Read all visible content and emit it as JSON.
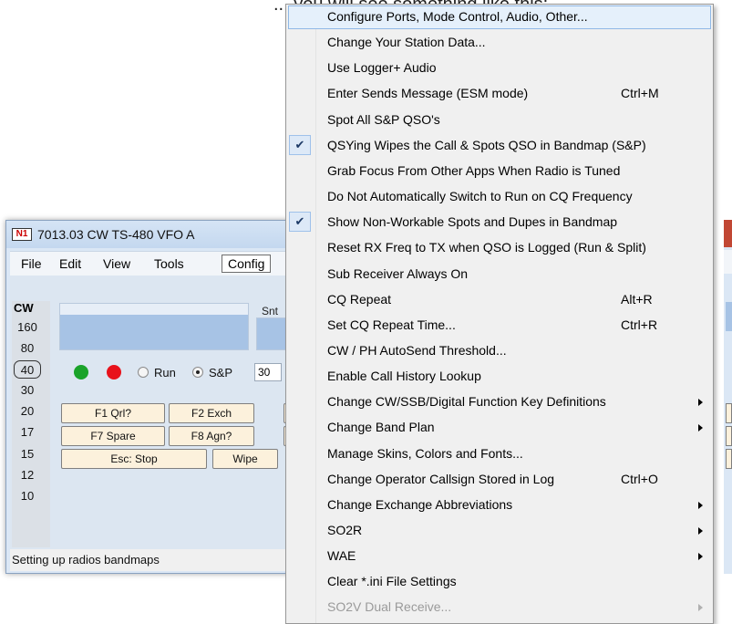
{
  "top_text": "... you will see something like this:",
  "window": {
    "icon_text": "N1",
    "title": "7013.03 CW TS-480 VFO A",
    "menu": [
      "File",
      "Edit",
      "View",
      "Tools",
      "Config"
    ],
    "mode": "CW",
    "bands": [
      "160",
      "80",
      "40",
      "30",
      "20",
      "17",
      "15",
      "12",
      "10"
    ],
    "selected_band": "40",
    "snt_label": "Snt",
    "radio_run": "Run",
    "radio_sp": "S&P",
    "sp_selected": true,
    "rst_value": "30",
    "fkeys": {
      "f1": "F1 Qrl?",
      "f2": "F2 Exch",
      "f7": "F7 Spare",
      "f8": "F8 Agn?",
      "esc": "Esc: Stop",
      "wipe": "Wipe"
    },
    "status": "Setting up radios  bandmaps"
  },
  "dropdown": {
    "items": [
      {
        "label": "Configure Ports, Mode Control, Audio, Other...",
        "shortcut": "",
        "checked": false,
        "submenu": false,
        "disabled": false,
        "highlighted": true
      },
      {
        "label": "Change Your Station Data...",
        "shortcut": "",
        "checked": false,
        "submenu": false,
        "disabled": false
      },
      {
        "label": "Use Logger+ Audio",
        "shortcut": "",
        "checked": false,
        "submenu": false,
        "disabled": false
      },
      {
        "label": "Enter Sends Message (ESM mode)",
        "shortcut": "Ctrl+M",
        "checked": false,
        "submenu": false,
        "disabled": false
      },
      {
        "label": "Spot All S&P QSO's",
        "shortcut": "",
        "checked": false,
        "submenu": false,
        "disabled": false
      },
      {
        "label": "QSYing Wipes the Call & Spots QSO in Bandmap (S&P)",
        "shortcut": "",
        "checked": true,
        "submenu": false,
        "disabled": false
      },
      {
        "label": "Grab Focus From Other Apps When Radio is Tuned",
        "shortcut": "",
        "checked": false,
        "submenu": false,
        "disabled": false
      },
      {
        "label": "Do Not Automatically Switch to Run on CQ Frequency",
        "shortcut": "",
        "checked": false,
        "submenu": false,
        "disabled": false
      },
      {
        "label": "Show Non-Workable Spots and Dupes in Bandmap",
        "shortcut": "",
        "checked": true,
        "submenu": false,
        "disabled": false
      },
      {
        "label": "Reset RX Freq to TX when QSO is Logged (Run & Split)",
        "shortcut": "",
        "checked": false,
        "submenu": false,
        "disabled": false
      },
      {
        "label": "Sub Receiver Always On",
        "shortcut": "",
        "checked": false,
        "submenu": false,
        "disabled": false
      },
      {
        "label": "CQ Repeat",
        "shortcut": "Alt+R",
        "checked": false,
        "submenu": false,
        "disabled": false
      },
      {
        "label": "Set CQ Repeat Time...",
        "shortcut": "Ctrl+R",
        "checked": false,
        "submenu": false,
        "disabled": false
      },
      {
        "label": "CW / PH AutoSend Threshold...",
        "shortcut": "",
        "checked": false,
        "submenu": false,
        "disabled": false
      },
      {
        "label": "Enable Call History Lookup",
        "shortcut": "",
        "checked": false,
        "submenu": false,
        "disabled": false
      },
      {
        "label": "Change CW/SSB/Digital Function Key Definitions",
        "shortcut": "",
        "checked": false,
        "submenu": true,
        "disabled": false
      },
      {
        "label": "Change Band Plan",
        "shortcut": "",
        "checked": false,
        "submenu": true,
        "disabled": false
      },
      {
        "label": "Manage Skins, Colors and Fonts...",
        "shortcut": "",
        "checked": false,
        "submenu": false,
        "disabled": false
      },
      {
        "label": "Change Operator Callsign Stored in Log",
        "shortcut": "Ctrl+O",
        "checked": false,
        "submenu": false,
        "disabled": false
      },
      {
        "label": "Change Exchange Abbreviations",
        "shortcut": "",
        "checked": false,
        "submenu": true,
        "disabled": false
      },
      {
        "label": "SO2R",
        "shortcut": "",
        "checked": false,
        "submenu": true,
        "disabled": false
      },
      {
        "label": "WAE",
        "shortcut": "",
        "checked": false,
        "submenu": true,
        "disabled": false
      },
      {
        "label": "Clear *.ini File Settings",
        "shortcut": "",
        "checked": false,
        "submenu": false,
        "disabled": false
      },
      {
        "label": "SO2V Dual Receive...",
        "shortcut": "",
        "checked": false,
        "submenu": true,
        "disabled": true
      }
    ]
  }
}
